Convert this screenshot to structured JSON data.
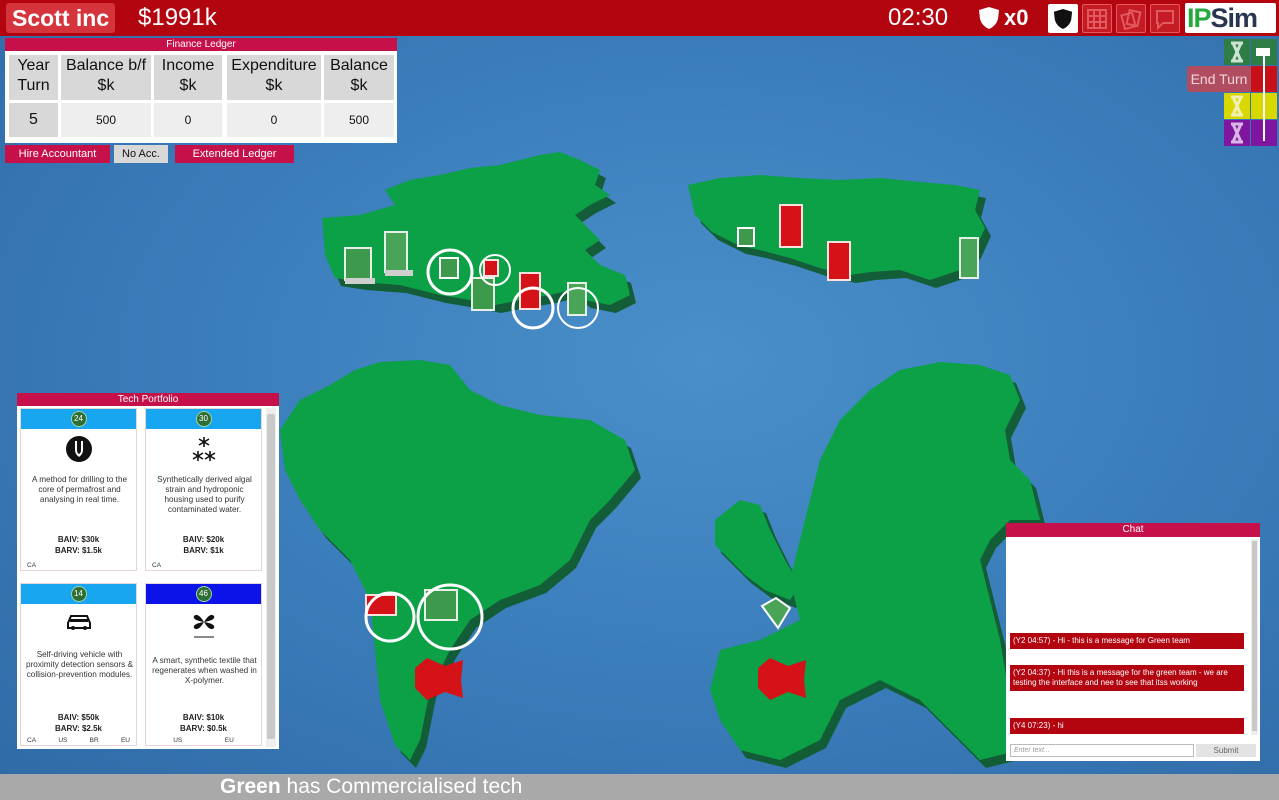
{
  "topbar": {
    "company": "Scott inc",
    "money": "$1991k",
    "timer": "02:30",
    "shield_count": "x0",
    "logo_ip": "IP",
    "logo_sim": "Sim",
    "buttons": [
      {
        "name": "shield-button-icon",
        "active": true
      },
      {
        "name": "grid-table-icon",
        "active": false
      },
      {
        "name": "cards-icon",
        "active": false
      },
      {
        "name": "chat-bubble-icon",
        "active": false
      }
    ]
  },
  "finance": {
    "title": "Finance Ledger",
    "headers": [
      "Year\nTurn",
      "Balance b/f\n$k",
      "Income\n$k",
      "Expenditure\n$k",
      "Balance\n$k"
    ],
    "row": [
      "5",
      "500",
      "0",
      "0",
      "500"
    ],
    "buttons": {
      "hire": "Hire Accountant",
      "no_acc": "No Acc.",
      "extended": "Extended Ledger"
    }
  },
  "turn": {
    "end_turn_label": "End Turn",
    "team_colors": [
      "#2e7d46",
      "#c8101a",
      "#d8d800",
      "#7f16a0"
    ]
  },
  "tech": {
    "title": "Tech Portfolio",
    "cards": [
      {
        "badge": "24",
        "icon": "drill-icon",
        "desc": "A method for drilling to the core of permafrost and analysing in real time.",
        "baiv": "BAIV: $30k",
        "barv": "BARV: $1.5k",
        "markets": [
          "CA"
        ],
        "header": "#19a6f0"
      },
      {
        "badge": "30",
        "icon": "algae-cluster-icon",
        "desc": "Synthetically derived algal strain and hydroponic housing used to purify contaminated water.",
        "baiv": "BAIV: $20k",
        "barv": "BARV: $1k",
        "markets": [
          "CA"
        ],
        "header": "#19a6f0"
      },
      {
        "badge": "14",
        "icon": "car-icon",
        "desc": "Self-driving vehicle with proximity detection sensors & collision-prevention modules.",
        "baiv": "BAIV: $50k",
        "barv": "BARV: $2.5k",
        "markets": [
          "CA",
          "US",
          "BR",
          "EU"
        ],
        "header": "#19a6f0"
      },
      {
        "badge": "46",
        "icon": "textile-icon",
        "desc": "A smart, synthetic textile that regenerates when washed in X-polymer.",
        "baiv": "BAIV: $10k",
        "barv": "BARV: $0.5k",
        "markets": [
          "US",
          "EU"
        ],
        "header": "#0b13e8"
      }
    ]
  },
  "chat": {
    "title": "Chat",
    "messages": [
      "(Y2 04:57) - Hi - this is a message for Green team",
      "(Y2 04:37) - Hi this is a message for the green team - we are testing the interface and nee to see that itss working",
      "(Y4 07:23) - hi"
    ],
    "input_placeholder": "Enter text...",
    "submit": "Submit"
  },
  "ticker": {
    "team": "Green",
    "message": "has Commercialised tech"
  },
  "colors": {
    "brand_red": "#b30510",
    "accent_pink": "#c6104a",
    "land_green": "#069c42",
    "sea_blue": "#3c7fbd"
  }
}
